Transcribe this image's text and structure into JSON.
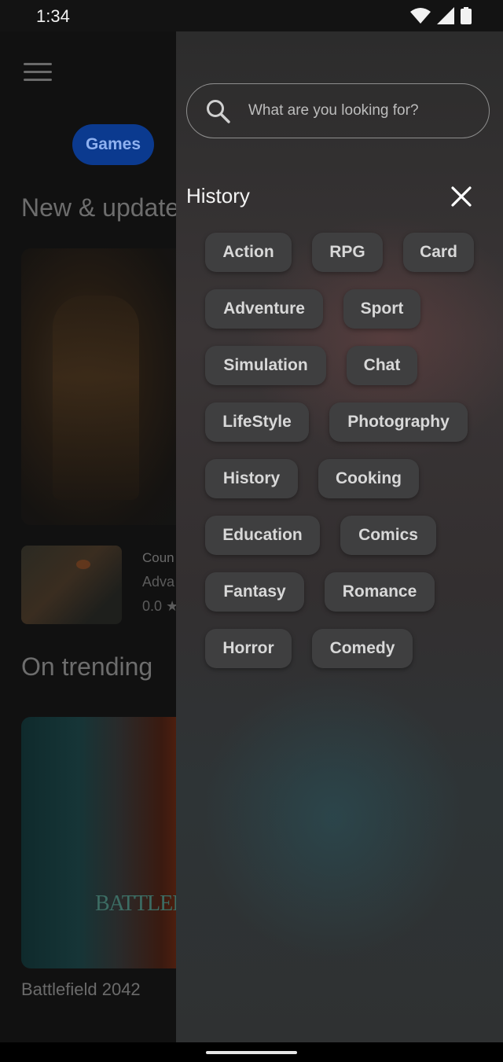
{
  "status_bar": {
    "time": "1:34",
    "icons": [
      "wifi-icon",
      "signal-icon",
      "battery-icon"
    ]
  },
  "background_app": {
    "category_chip": "Games",
    "section_new": "New & update",
    "featured_row": {
      "title_fragment": "Coun",
      "subtitle_fragment": "Adva",
      "rating": "0.0 ★"
    },
    "section_trending": "On trending",
    "trending_title": "Battlefield 2042",
    "trending_logo_text": "BATTLEFIELD"
  },
  "drawer": {
    "search": {
      "placeholder": "What are you looking for?",
      "value": ""
    },
    "history_title": "History",
    "tags": [
      [
        "Action",
        "RPG",
        "Card"
      ],
      [
        "Adventure",
        "Sport"
      ],
      [
        "Simulation",
        "Chat"
      ],
      [
        "LifeStyle",
        "Photography"
      ],
      [
        "History",
        "Cooking"
      ],
      [
        "Education",
        "Comics"
      ],
      [
        "Fantasy",
        "Romance"
      ],
      [
        "Horror",
        "Comedy"
      ]
    ]
  },
  "colors": {
    "chip_bg": "#0b3a8f",
    "tag_bg": "#3f3f40",
    "drawer_text": "#f4f4f4"
  }
}
